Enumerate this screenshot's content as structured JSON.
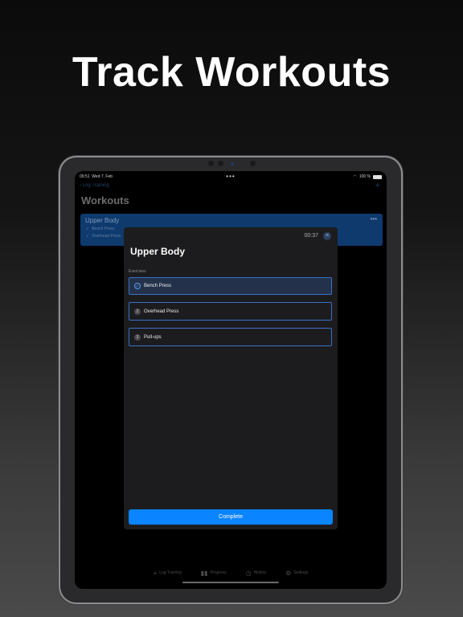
{
  "headline": "Track Workouts",
  "status_bar": {
    "time": "09:51",
    "date": "Wed 7. Feb",
    "battery": "100 %"
  },
  "nav": {
    "back_label": "Log Training"
  },
  "list": {
    "title": "Workouts",
    "card": {
      "title": "Upper Body",
      "rows": [
        "Bench Press",
        "Overhead Press"
      ]
    }
  },
  "modal": {
    "timer": "00:37",
    "title": "Upper Body",
    "exercises_label": "Exercises",
    "exercises": [
      {
        "name": "Bench Press",
        "marker": "✓",
        "done": true
      },
      {
        "name": "Overhead Press",
        "marker": "2",
        "done": false
      },
      {
        "name": "Pull-ups",
        "marker": "3",
        "done": false
      }
    ],
    "complete_label": "Complete"
  },
  "tabbar": [
    {
      "label": "Log Training",
      "icon": "plus-icon"
    },
    {
      "label": "Progress",
      "icon": "bar-chart-icon"
    },
    {
      "label": "History",
      "icon": "clock-icon"
    },
    {
      "label": "Settings",
      "icon": "gear-icon"
    }
  ],
  "colors": {
    "accent": "#0a84ff",
    "card_bg": "#0e3a6e",
    "modal_bg": "#1c1c1e"
  }
}
